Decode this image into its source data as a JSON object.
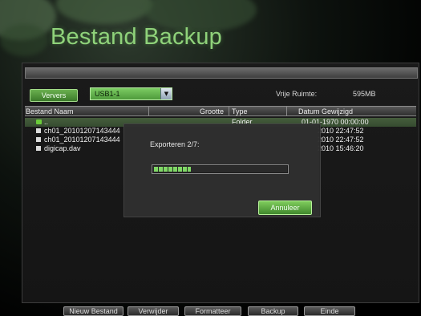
{
  "page": {
    "title": "Bestand Backup"
  },
  "toolbar": {
    "refresh_label": "Ververs",
    "device_select": "USB1-1",
    "free_space_label": "Vrije Ruimte:",
    "free_space_value": "595MB"
  },
  "table": {
    "columns": [
      "Bestand Naam",
      "Grootte",
      "Type",
      "Datum Gewijzigd"
    ],
    "rows": [
      {
        "name": "..",
        "size": "",
        "type": "Folder",
        "date": "01-01-1970 00:00:00",
        "icon": "folder-icon"
      },
      {
        "name": "ch01_20101207143444",
        "size": "",
        "type": "",
        "date": "2010 22:47:52",
        "icon": "file-icon"
      },
      {
        "name": "ch01_20101207143444",
        "size": "",
        "type": "",
        "date": "2010 22:47:52",
        "icon": "file-icon"
      },
      {
        "name": "digicap.dav",
        "size": "",
        "type": "",
        "date": "2010 15:46:20",
        "icon": "file-icon"
      }
    ]
  },
  "dialog": {
    "message": "Exporteren 2/7:",
    "progress_fraction": 0.28,
    "cancel_label": "Annuleer"
  },
  "bottom_buttons": {
    "new_file": "Nieuw Bestand",
    "delete": "Verwijder",
    "format": "Formatteer",
    "backup": "Backup",
    "exit": "Einde"
  },
  "colors": {
    "accent_green": "#6ab04f",
    "title_green": "#8fd27a",
    "selection": "#455d3c"
  }
}
